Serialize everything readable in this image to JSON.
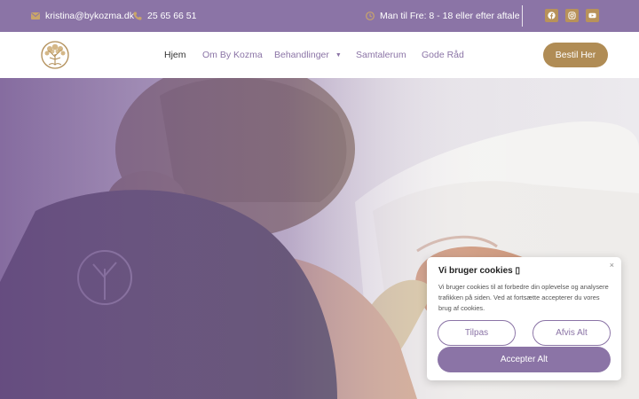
{
  "topbar": {
    "email": "kristina@bykozma.dk",
    "phone": "25 65 66 51",
    "hours": "Man til Fre: 8 - 18 eller efter aftale",
    "email_icon": "envelope-icon",
    "phone_icon": "phone-icon",
    "hours_icon": "clock-icon",
    "social": [
      "facebook-icon",
      "instagram-icon",
      "youtube-icon"
    ]
  },
  "header": {
    "logo_icon": "tree-of-life-logo",
    "nav": [
      {
        "label": "Hjem",
        "active": true
      },
      {
        "label": "Om By Kozma"
      },
      {
        "label": "Behandlinger",
        "has_dropdown": true
      },
      {
        "label": "Samtalerum"
      },
      {
        "label": "Gode Råd"
      }
    ],
    "cta_label": "Bestil Her"
  },
  "cookie": {
    "title": "Vi bruger cookies",
    "title_suffix": "▯",
    "message": "Vi bruger cookies til at forbedre din oplevelse og analysere trafikken på siden. Ved at fortsætte accepterer du vores brug af cookies.",
    "close_label": "×",
    "customize_label": "Tilpas",
    "reject_label": "Afvis Alt",
    "accept_label": "Accepter Alt"
  },
  "colors": {
    "brand_purple": "#8b74a6",
    "brand_gold": "#b08c55"
  }
}
